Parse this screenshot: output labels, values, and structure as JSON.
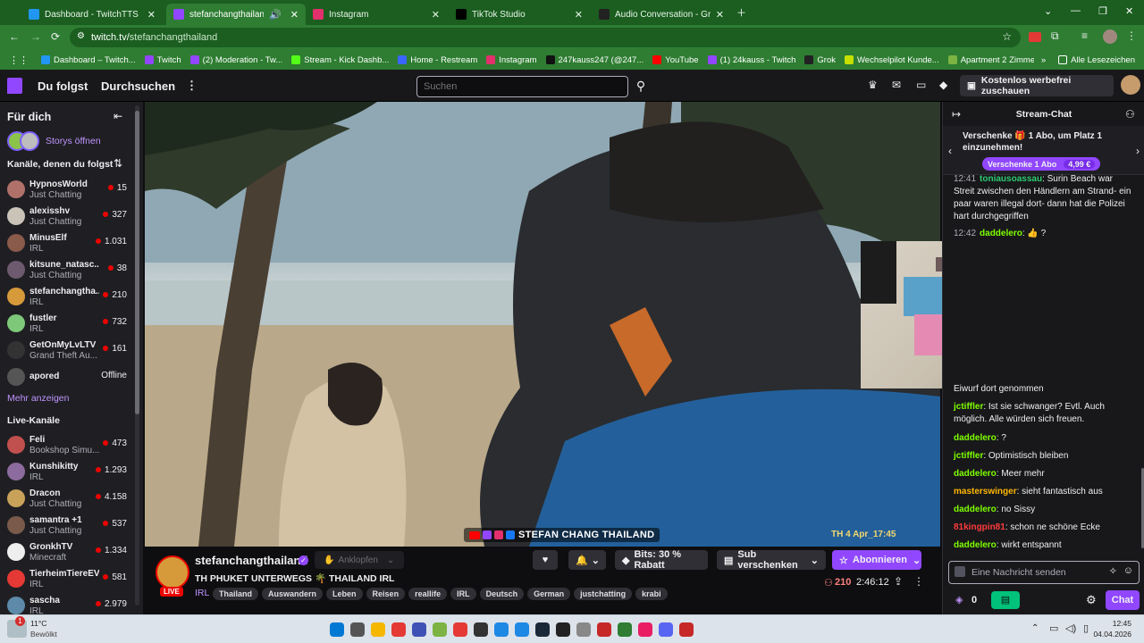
{
  "browser": {
    "tabs": [
      {
        "label": "Dashboard - TwitchTTS",
        "active": false,
        "color": "#2196f3"
      },
      {
        "label": "stefanchangthailand - Twitch",
        "active": true,
        "color": "#9146ff"
      },
      {
        "label": "Instagram",
        "active": false,
        "color": "#e1306c"
      },
      {
        "label": "TikTok Studio",
        "active": false,
        "color": "#000000"
      },
      {
        "label": "Audio Conversation - Grok",
        "active": false,
        "color": "#222222"
      }
    ],
    "url_host": "twitch.tv/",
    "url_path": "stefanchangthailand",
    "bookmarks": [
      {
        "label": "Dashboard – Twitch...",
        "color": "#2196f3"
      },
      {
        "label": "Twitch",
        "color": "#9146ff"
      },
      {
        "label": "(2) Moderation - Tw...",
        "color": "#9146ff"
      },
      {
        "label": "Stream - Kick Dashb...",
        "color": "#53fc18"
      },
      {
        "label": "Home - Restream",
        "color": "#3a66ff"
      },
      {
        "label": "Instagram",
        "color": "#e1306c"
      },
      {
        "label": "247kauss247 (@247...",
        "color": "#111111"
      },
      {
        "label": "YouTube",
        "color": "#ff0000"
      },
      {
        "label": "(1) 24kauss - Twitch",
        "color": "#9146ff"
      },
      {
        "label": "Grok",
        "color": "#222222"
      },
      {
        "label": "Wechselpilot Kunde...",
        "color": "#c6e000"
      },
      {
        "label": "Apartment 2 Zimme...",
        "color": "#7cb342"
      },
      {
        "label": "ARC Raiders – Die...",
        "color": "#f57c00"
      }
    ],
    "all_bookmarks": "Alle Lesezeichen"
  },
  "twitch": {
    "nav": {
      "following": "Du folgst",
      "browse": "Durchsuchen",
      "search_placeholder": "Suchen",
      "adfree": "Kostenlos werbefrei zuschauen"
    },
    "sidebar": {
      "title": "Für dich",
      "stories": "Storys öffnen",
      "followed_header": "Kanäle, denen du folgst",
      "show_more": "Mehr anzeigen",
      "live_header": "Live-Kanäle",
      "followed": [
        {
          "name": "HypnosWorld",
          "cat": "Just Chatting",
          "viewers": "15",
          "color": "#b0716b"
        },
        {
          "name": "alexisshv",
          "cat": "Just Chatting",
          "viewers": "327",
          "color": "#c9c3b8"
        },
        {
          "name": "MinusElf",
          "cat": "IRL",
          "viewers": "1.031",
          "color": "#8a5a4a"
        },
        {
          "name": "kitsune_natasc...",
          "cat": "Just Chatting",
          "viewers": "38",
          "color": "#6d5a6e"
        },
        {
          "name": "stefanchangtha...",
          "cat": "IRL",
          "viewers": "210",
          "color": "#d79a3a"
        },
        {
          "name": "fustler",
          "cat": "IRL",
          "viewers": "732",
          "color": "#7ec87a"
        },
        {
          "name": "GetOnMyLvLTV",
          "cat": "Grand Theft Au...",
          "viewers": "161",
          "color": "#333"
        },
        {
          "name": "apored",
          "cat": "",
          "viewers": "Offline",
          "color": "#555"
        }
      ],
      "live": [
        {
          "name": "Feli",
          "cat": "Bookshop Simu...",
          "viewers": "473",
          "color": "#c0504d"
        },
        {
          "name": "Kunshikitty",
          "cat": "IRL",
          "viewers": "1.293",
          "color": "#8c6b9e"
        },
        {
          "name": "Dracon",
          "cat": "Just Chatting",
          "viewers": "4.158",
          "color": "#c9a25a"
        },
        {
          "name": "samantra +1",
          "cat": "Just Chatting",
          "viewers": "537",
          "color": "#7a5a4a"
        },
        {
          "name": "GronkhTV",
          "cat": "Minecraft",
          "viewers": "1.334",
          "color": "#eeeeee"
        },
        {
          "name": "TierheimTiereEV",
          "cat": "IRL",
          "viewers": "581",
          "color": "#e53935"
        },
        {
          "name": "sascha",
          "cat": "IRL",
          "viewers": "2.979",
          "color": "#5d8aa8"
        }
      ]
    },
    "video": {
      "overlay_name": "STEFAN CHANG THAILAND",
      "timestamp": "TH 4 Apr_17:45"
    },
    "stream": {
      "channel": "stefanchangthailand",
      "knock": "Anklopfen",
      "live": "LIVE",
      "title": "TH PHUKET UNTERWEGS 🌴 THAILAND IRL",
      "category": "IRL",
      "tags": [
        "Thailand",
        "Auswandern",
        "Leben",
        "Reisen",
        "reallife",
        "IRL",
        "Deutsch",
        "German",
        "justchatting",
        "krabi"
      ],
      "bits": "Bits: 30 % Rabatt",
      "gift": "Sub verschenken",
      "subscribe": "Abonnieren",
      "viewers": "210",
      "uptime": "2:46:12"
    },
    "chat": {
      "title": "Stream-Chat",
      "promo": "Verschenke 🎁 1 Abo, um Platz 1 einzunehmen!",
      "promo_btn": "Verschenke 1 Abo",
      "promo_price": "4,99 €",
      "input_placeholder": "Eine Nachricht senden",
      "points": "0",
      "send": "Chat",
      "messages": [
        {
          "time": "12:41",
          "user": "toniausoassau",
          "color": "#2ecc71",
          "text": ": Surin Beach war Streit zwischen den Händlern am Strand- ein paar waren illegal dort- dann hat die Polizei hart durchgegriffen"
        },
        {
          "time": "12:42",
          "user": "daddelero",
          "color": "#7fff00",
          "text": ": 👍 ?"
        },
        {
          "time": "",
          "user": "",
          "color": "#efeff1",
          "text": "Eiwurf dort genommen"
        },
        {
          "time": "",
          "user": "jctiffler",
          "color": "#7fff00",
          "text": ": Ist sie schwanger? Evtl. Auch möglich. Alle würden sich freuen."
        },
        {
          "time": "",
          "user": "daddelero",
          "color": "#7fff00",
          "text": ": ?"
        },
        {
          "time": "",
          "user": "jctiffler",
          "color": "#7fff00",
          "text": ": Optimistisch bleiben"
        },
        {
          "time": "",
          "user": "daddelero",
          "color": "#7fff00",
          "text": ": Meer mehr"
        },
        {
          "time": "",
          "user": "masterswinger",
          "color": "#ffb700",
          "text": ": sieht fantastisch aus"
        },
        {
          "time": "",
          "user": "daddelero",
          "color": "#7fff00",
          "text": ": no Sissy"
        },
        {
          "time": "",
          "user": "81kingpin81",
          "color": "#ff3b3b",
          "text": ": schon ne schöne Ecke"
        },
        {
          "time": "",
          "user": "daddelero",
          "color": "#7fff00",
          "text": ": wirkt entspannt"
        }
      ]
    }
  },
  "taskbar": {
    "weather_temp": "11°C",
    "weather_text": "Bewölkt",
    "notif_count": "1",
    "time": "12:45",
    "date": "04.04.2026"
  },
  "colors": {
    "twitch_purple": "#9147ff",
    "live_red": "#eb0400",
    "chrome_green": "#2e7d32"
  }
}
